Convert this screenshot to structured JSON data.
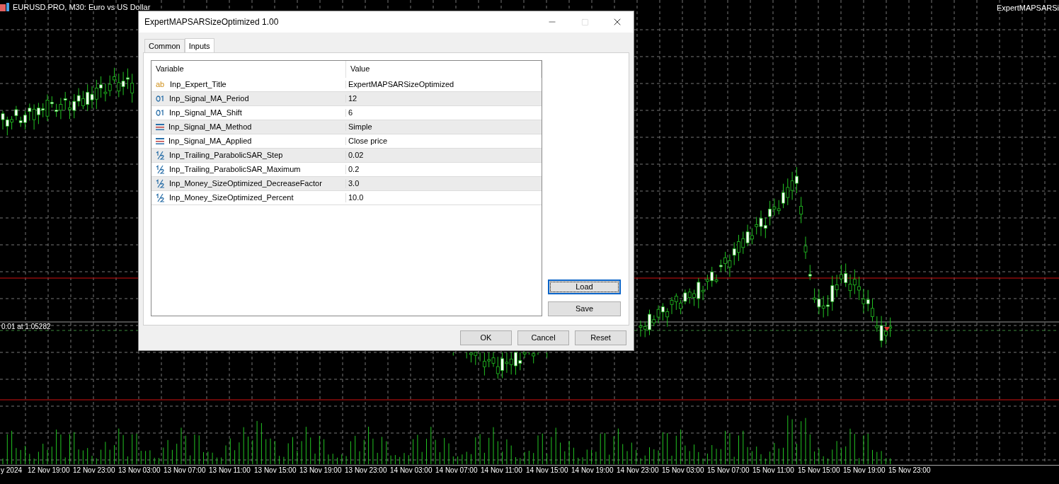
{
  "chart": {
    "title": "EURUSD.PRO, M30:  Euro vs US Dollar",
    "expert_label": "ExpertMAPSARSi",
    "trade_label": "0.01 at 1.05282",
    "time_labels": [
      "y 2024",
      "12 Nov 19:00",
      "12 Nov 23:00",
      "13 Nov 03:00",
      "13 Nov 07:00",
      "13 Nov 11:00",
      "13 Nov 15:00",
      "13 Nov 19:00",
      "13 Nov 23:00",
      "14 Nov 03:00",
      "14 Nov 07:00",
      "14 Nov 11:00",
      "14 Nov 15:00",
      "14 Nov 19:00",
      "14 Nov 23:00",
      "15 Nov 03:00",
      "15 Nov 07:00",
      "15 Nov 11:00",
      "15 Nov 15:00",
      "15 Nov 19:00",
      "15 Nov 23:00"
    ]
  },
  "dialog": {
    "title": "ExpertMAPSARSizeOptimized 1.00",
    "tabs": [
      {
        "label": "Common",
        "selected": false
      },
      {
        "label": "Inputs",
        "selected": true
      }
    ],
    "columns": [
      "Variable",
      "Value"
    ],
    "rows": [
      {
        "kind": "string",
        "icon_text": "ab",
        "variable": "Inp_Expert_Title",
        "value": "ExpertMAPSARSizeOptimized"
      },
      {
        "kind": "int",
        "variable": "Inp_Signal_MA_Period",
        "value": "12"
      },
      {
        "kind": "int",
        "variable": "Inp_Signal_MA_Shift",
        "value": "6"
      },
      {
        "kind": "enum",
        "variable": "Inp_Signal_MA_Method",
        "value": "Simple"
      },
      {
        "kind": "enum",
        "variable": "Inp_Signal_MA_Applied",
        "value": "Close price"
      },
      {
        "kind": "double",
        "variable": "Inp_Trailing_ParabolicSAR_Step",
        "value": "0.02"
      },
      {
        "kind": "double",
        "variable": "Inp_Trailing_ParabolicSAR_Maximum",
        "value": "0.2"
      },
      {
        "kind": "double",
        "variable": "Inp_Money_SizeOptimized_DecreaseFactor",
        "value": "3.0"
      },
      {
        "kind": "double",
        "variable": "Inp_Money_SizeOptimized_Percent",
        "value": "10.0"
      }
    ],
    "side_buttons": [
      {
        "label": "Load",
        "focused": true
      },
      {
        "label": "Save",
        "focused": false
      }
    ],
    "buttons": [
      "OK",
      "Cancel",
      "Reset"
    ]
  }
}
